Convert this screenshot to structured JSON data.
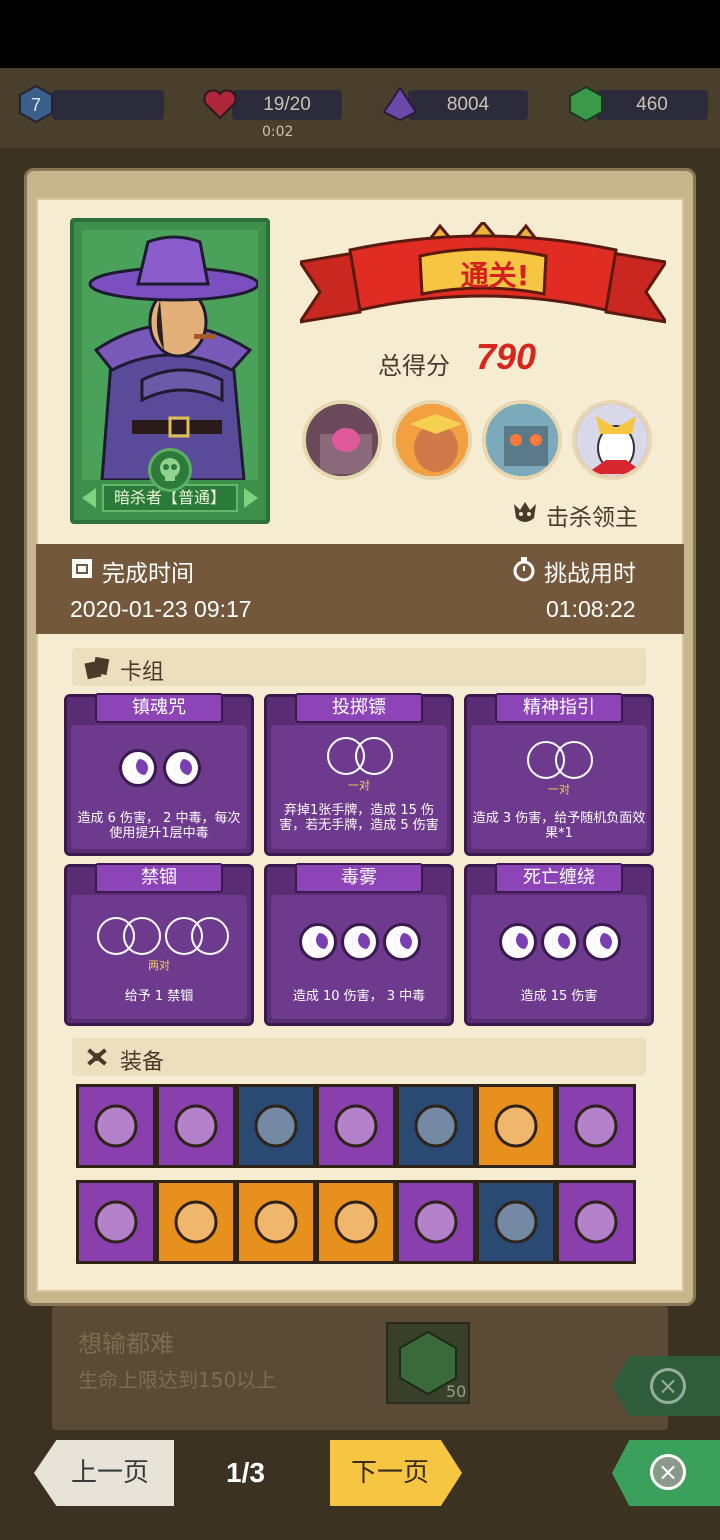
{
  "top_stats": {
    "level": "7",
    "hp": "19/20",
    "crystals": "8004",
    "gems": "460",
    "timer": "0:02"
  },
  "banner": {
    "text": "通关!"
  },
  "score": {
    "label": "总得分",
    "value": "790"
  },
  "kill": {
    "label": "击杀领主"
  },
  "hero": {
    "name": "暗杀者【普通】"
  },
  "time": {
    "finish_label": "完成时间",
    "finish_value": "2020-01-23 09:17",
    "duration_label": "挑战用时",
    "duration_value": "01:08:22"
  },
  "deck": {
    "title": "卡组",
    "cards": [
      {
        "name": "镇魂咒",
        "sub": "",
        "desc": "造成 6 伤害， 2 中毒，每次使用提升1层中毒"
      },
      {
        "name": "投掷镖",
        "sub": "一对",
        "desc": "弃掉1张手牌，造成 15 伤害，若无手牌，造成 5 伤害"
      },
      {
        "name": "精神指引",
        "sub": "一对",
        "desc": "造成 3 伤害，给予随机负面效果*1"
      },
      {
        "name": "禁锢",
        "sub": "两对",
        "desc": "给予 1 禁锢"
      },
      {
        "name": "毒雾",
        "sub": "",
        "desc": "造成 10 伤害， 3 中毒"
      },
      {
        "name": "死亡缠绕",
        "sub": "",
        "desc": "造成 15 伤害"
      }
    ]
  },
  "equipment": {
    "title": "装备",
    "row1": [
      {
        "icon": "claw-blade-icon",
        "color": "#8a3fae"
      },
      {
        "icon": "glove-icon",
        "color": "#8a3fae"
      },
      {
        "icon": "top-hat-icon",
        "color": "#2a4a74"
      },
      {
        "icon": "chain-icon",
        "color": "#8a3fae"
      },
      {
        "icon": "open-chest-icon",
        "color": "#2a4a74"
      },
      {
        "icon": "potion-flask-icon",
        "color": "#e8901e"
      },
      {
        "icon": "pink-gem-icon",
        "color": "#8a3fae"
      }
    ],
    "row2": [
      {
        "icon": "scroll-icon",
        "color": "#8a3fae"
      },
      {
        "icon": "spiked-collar-icon",
        "color": "#e8901e"
      },
      {
        "icon": "moon-stone-icon",
        "color": "#e8901e"
      },
      {
        "icon": "skull-crystal-icon",
        "color": "#e8901e"
      },
      {
        "icon": "boot-icon",
        "color": "#8a3fae"
      },
      {
        "icon": "green-gem-icon",
        "color": "#2a4a74"
      },
      {
        "icon": "slime-splat-icon",
        "color": "#8a3fae"
      }
    ]
  },
  "background_achievement": {
    "title": "想输都难",
    "subtitle": "生命上限达到150以上",
    "reward": "50"
  },
  "nav": {
    "prev": "上一页",
    "page": "1/3",
    "next": "下一页"
  }
}
